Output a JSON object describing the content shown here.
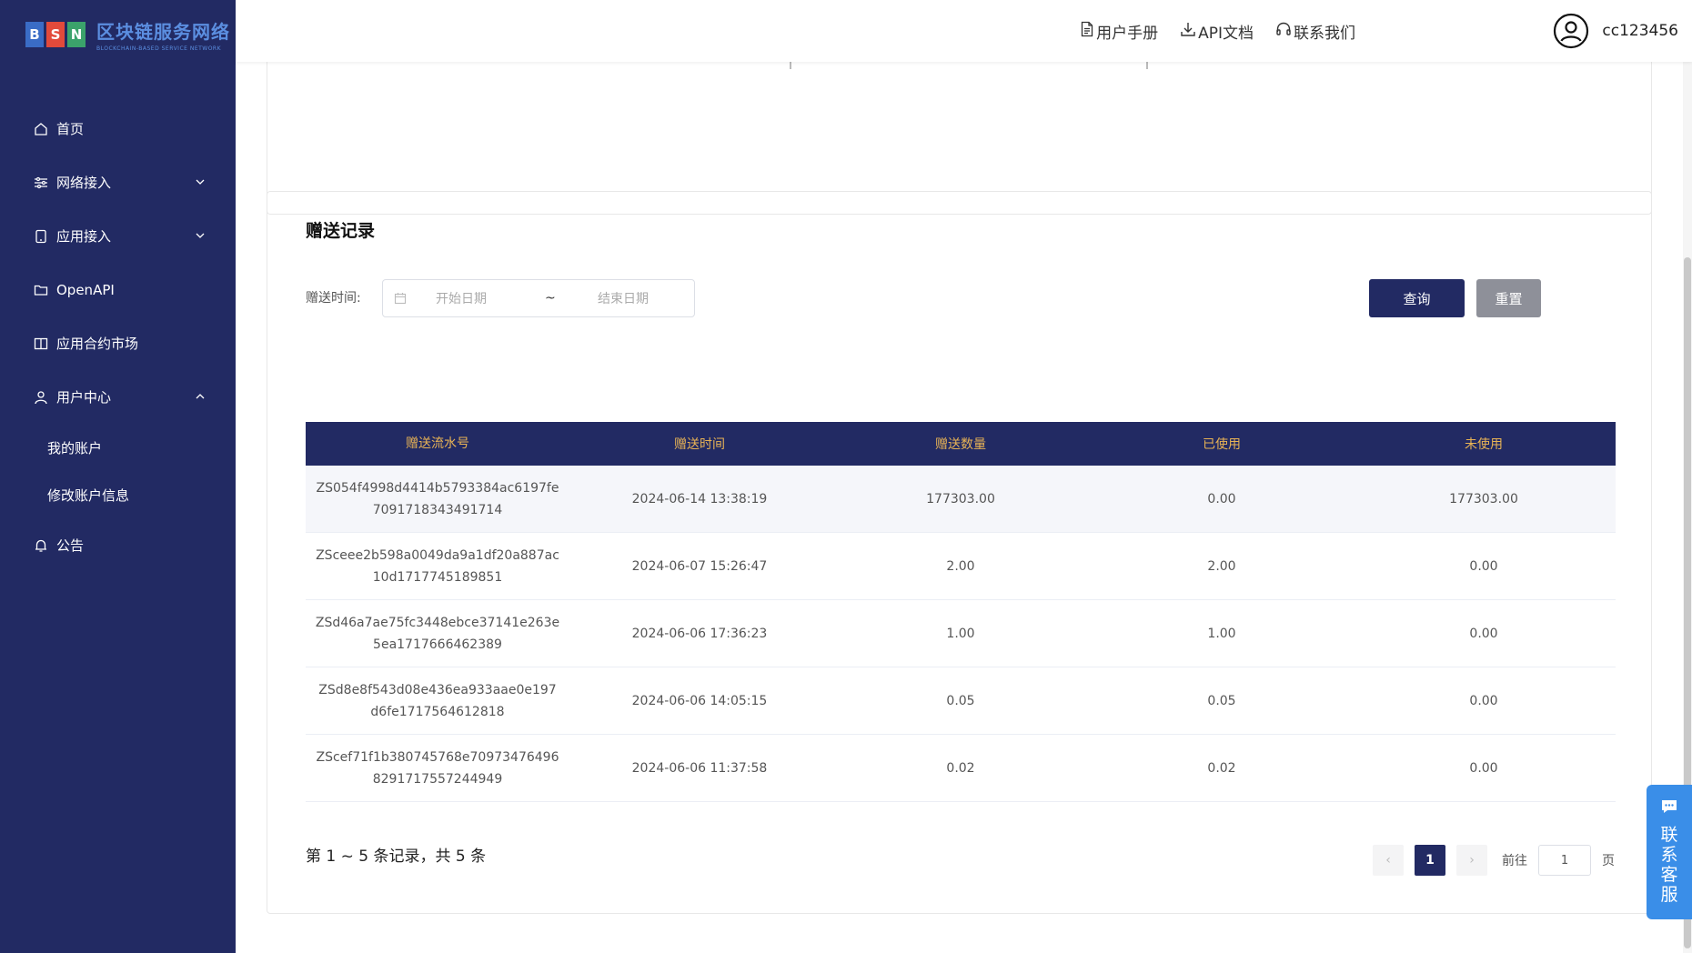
{
  "brand": {
    "letters": [
      "B",
      "S",
      "N"
    ],
    "name": "区块链服务网络",
    "subtitle": "BLOCKCHAIN-BASED SERVICE NETWORK"
  },
  "sidebar": {
    "items": [
      {
        "label": "首页",
        "icon": "home-icon"
      },
      {
        "label": "网络接入",
        "icon": "sliders-icon",
        "expandable": true
      },
      {
        "label": "应用接入",
        "icon": "tablet-icon",
        "expandable": true
      },
      {
        "label": "OpenAPI",
        "icon": "folder-icon"
      },
      {
        "label": "应用合约市场",
        "icon": "book-icon"
      },
      {
        "label": "用户中心",
        "icon": "user-icon",
        "expanded": true
      },
      {
        "label": "公告",
        "icon": "bell-icon"
      }
    ],
    "sub_items": [
      {
        "label": "我的账户"
      },
      {
        "label": "修改账户信息"
      }
    ]
  },
  "header": {
    "links": [
      {
        "label": "用户手册",
        "icon": "document-icon"
      },
      {
        "label": "API文档",
        "icon": "download-icon"
      },
      {
        "label": "联系我们",
        "icon": "headset-icon"
      }
    ],
    "username": "cc123456"
  },
  "records": {
    "title": "赠送记录",
    "filter_label": "赠送时间:",
    "start_placeholder": "开始日期",
    "separator": "~",
    "end_placeholder": "结束日期",
    "query_label": "查询",
    "reset_label": "重置",
    "columns": [
      "赠送流水号",
      "赠送时间",
      "赠送数量",
      "已使用",
      "未使用"
    ],
    "rows": [
      {
        "serial": "ZS054f4998d4414b5793384ac6197fe7091718343491714",
        "time": "2024-06-14 13:38:19",
        "amount": "177303.00",
        "used": "0.00",
        "unused": "177303.00"
      },
      {
        "serial": "ZSceee2b598a0049da9a1df20a887ac10d1717745189851",
        "time": "2024-06-07 15:26:47",
        "amount": "2.00",
        "used": "2.00",
        "unused": "0.00"
      },
      {
        "serial": "ZSd46a7ae75fc3448ebce37141e263e5ea1717666462389",
        "time": "2024-06-06 17:36:23",
        "amount": "1.00",
        "used": "1.00",
        "unused": "0.00"
      },
      {
        "serial": "ZSd8e8f543d08e436ea933aae0e197d6fe1717564612818",
        "time": "2024-06-06 14:05:15",
        "amount": "0.05",
        "used": "0.05",
        "unused": "0.00"
      },
      {
        "serial": "ZScef71f1b380745768e709734764968291717557244949",
        "time": "2024-06-06 11:37:58",
        "amount": "0.02",
        "used": "0.02",
        "unused": "0.00"
      }
    ],
    "summary": "第 1 ~ 5 条记录，共 5 条",
    "pagination": {
      "prev": "‹",
      "current_page": "1",
      "next": "›",
      "goto_label": "前往",
      "goto_value": "1",
      "page_suffix": "页"
    }
  },
  "float_contact": {
    "label": "联系客服",
    "icon": "chat-icon"
  },
  "colors": {
    "sidebar_bg": "#222a63",
    "table_header_bg": "#222a63",
    "table_header_text": "#e8b355",
    "primary_button": "#222a63",
    "reset_button": "#8e9099",
    "float_button": "#3a8ee8"
  }
}
